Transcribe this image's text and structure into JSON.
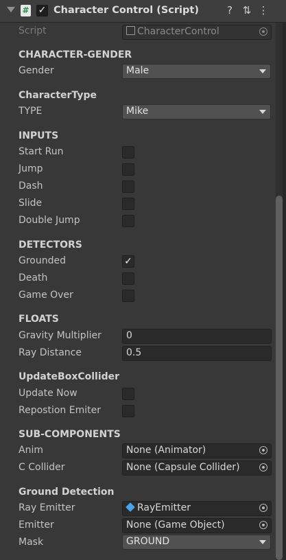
{
  "header": {
    "title": "Character Control (Script)",
    "script_icon_glyph": "#",
    "enabled_glyph": "✓",
    "help_glyph": "?",
    "preset_glyph": "⇅",
    "more_glyph": "⋮"
  },
  "script_row": {
    "label": "Script",
    "value": "CharacterControl"
  },
  "sections": {
    "gender": {
      "title": "CHARACTER-GENDER",
      "label": "Gender",
      "value": "Male"
    },
    "type": {
      "title": "CharacterType",
      "label": "TYPE",
      "value": "Mike"
    },
    "inputs": {
      "title": "INPUTS",
      "start_run": "Start Run",
      "jump": "Jump",
      "dash": "Dash",
      "slide": "Slide",
      "double_jump": "Double Jump"
    },
    "detectors": {
      "title": "DETECTORS",
      "grounded": "Grounded",
      "death": "Death",
      "game_over": "Game Over",
      "check_glyph": "✓"
    },
    "floats": {
      "title": "FLOATS",
      "gravity_label": "Gravity Multiplier",
      "gravity_value": "0",
      "ray_label": "Ray Distance",
      "ray_value": "0.5"
    },
    "update_box": {
      "title": "UpdateBoxCollider",
      "update_now": "Update Now",
      "repostion": "Repostion Emiter"
    },
    "sub_components": {
      "title": "SUB-COMPONENTS",
      "anim_label": "Anim",
      "anim_value": "None (Animator)",
      "collider_label": "C Collider",
      "collider_value": "None (Capsule Collider)"
    },
    "ground": {
      "title": "Ground Detection",
      "ray_emitter_label": "Ray Emitter",
      "ray_emitter_value": "RayEmitter",
      "emitter_label": "Emitter",
      "emitter_value": "None (Game Object)",
      "mask_label": "Mask",
      "mask_value": "GROUND"
    }
  },
  "icons": {
    "object_picker": "object-picker-icon",
    "dropdown": "dropdown-arrow-icon",
    "gameobject": "gameobject-cube-icon"
  },
  "colors": {
    "background": "#383838",
    "header": "#3e3e3e",
    "field": "#2a2a2a",
    "dropdown": "#515151",
    "cube_blue": "#4aa3e8"
  }
}
